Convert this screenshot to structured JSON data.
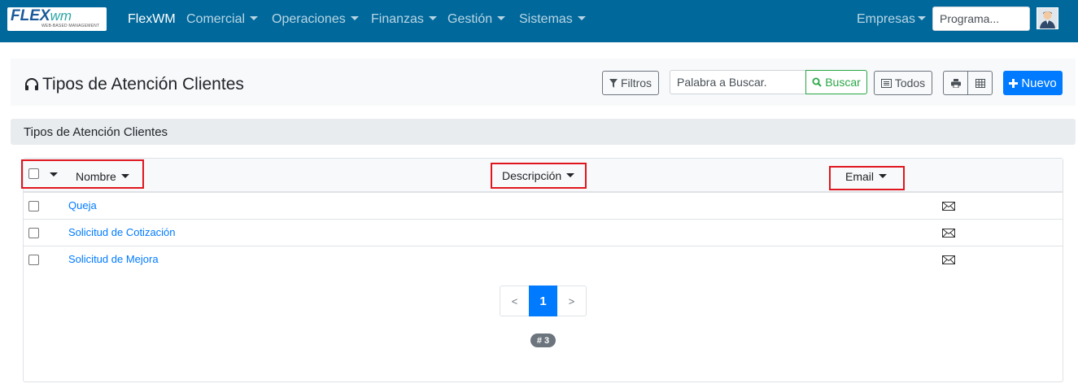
{
  "navbar": {
    "logo": {
      "main": "FLEX",
      "wm": "wm",
      "sub": "WEB-BASED MANAGEMENT"
    },
    "brand": "FlexWM",
    "menus": [
      "Comercial",
      "Operaciones",
      "Finanzas",
      "Gestión",
      "Sistemas"
    ],
    "company_menu": "Empresas",
    "search_placeholder": "Programa...",
    "bg_color": "#00689b"
  },
  "header": {
    "title": "Tipos de Atención Clientes",
    "title_icon": "headphones-icon",
    "filters_label": "Filtros",
    "search_placeholder": "Palabra a Buscar.",
    "search_button": "Buscar",
    "all_label": "Todos",
    "new_label": "Nuevo"
  },
  "section": {
    "title": "Tipos de Atención Clientes"
  },
  "table": {
    "columns": [
      "Nombre",
      "Descripción",
      "Email"
    ],
    "rows": [
      {
        "name": "Queja",
        "description": "",
        "email_icon": "envelope-icon"
      },
      {
        "name": "Solicitud de Cotización",
        "description": "",
        "email_icon": "envelope-icon"
      },
      {
        "name": "Solicitud de Mejora",
        "description": "",
        "email_icon": "envelope-icon"
      }
    ]
  },
  "pagination": {
    "prev": "<",
    "current": "1",
    "next": ">"
  },
  "count_badge": "# 3",
  "colors": {
    "primary": "#007bff",
    "success": "#28a745",
    "highlight": "#e0161f"
  }
}
